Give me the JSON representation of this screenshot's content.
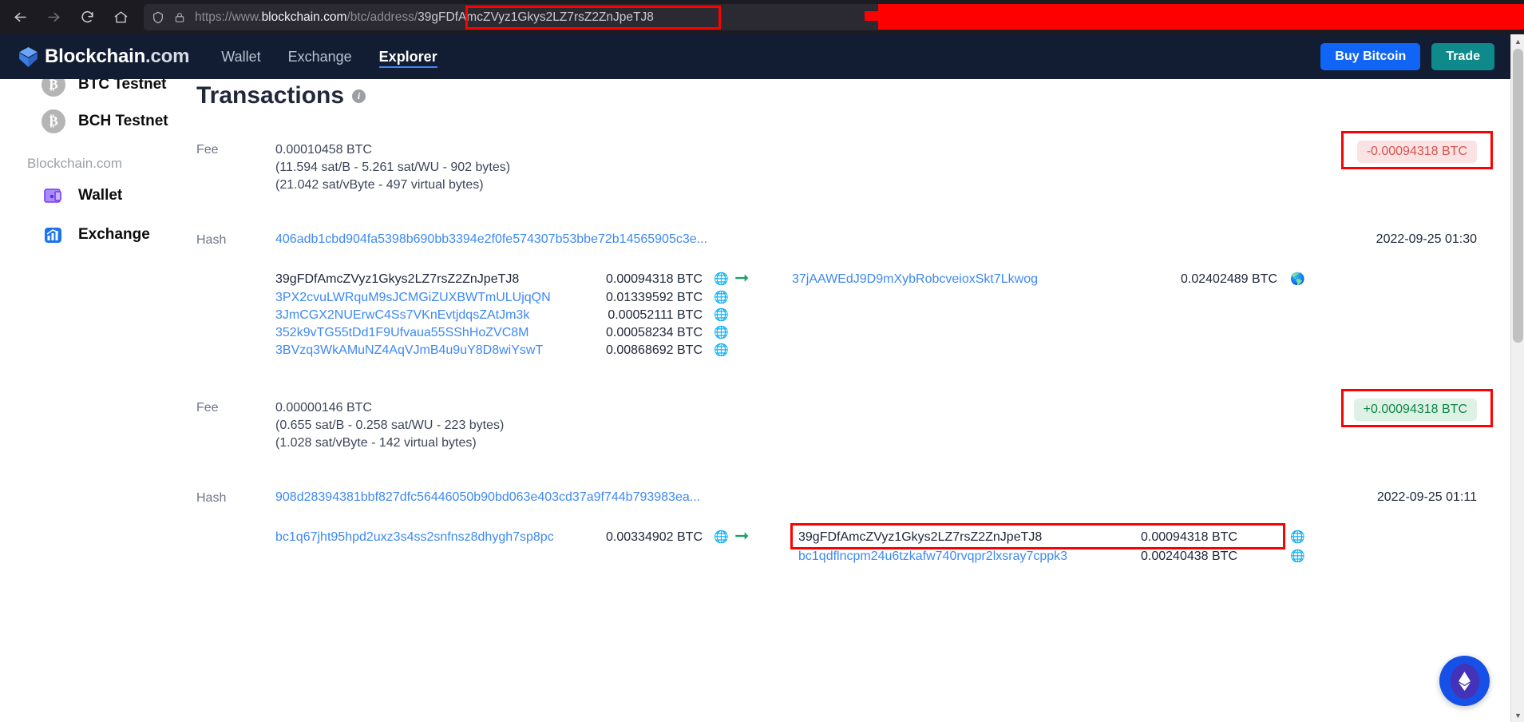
{
  "browser": {
    "back_icon": "back-arrow-icon",
    "forward_icon": "forward-arrow-icon",
    "reload_icon": "reload-icon",
    "home_icon": "home-icon",
    "shield_icon": "shield-icon",
    "lock_icon": "lock-icon",
    "url_prefix": "https://www.",
    "url_domain": "blockchain.com",
    "url_path": "/btc/address/",
    "url_address": "39gFDfAmcZVyz1Gkys2LZ7rsZ2ZnJpeTJ8",
    "annotation_color": "#ff0000"
  },
  "header": {
    "brand": "Blockchain",
    "brand_suffix": ".com",
    "nav": [
      {
        "label": "Wallet",
        "active": false
      },
      {
        "label": "Exchange",
        "active": false
      },
      {
        "label": "Explorer",
        "active": true
      }
    ],
    "buy_bitcoin_label": "Buy Bitcoin",
    "trade_label": "Trade",
    "buy_bitcoin_color": "#1165f6",
    "trade_color": "#0e8a8a",
    "background_color": "#121d33"
  },
  "sidebar": {
    "items": [
      {
        "label": "BTC Testnet",
        "icon": "bitcoin-coin-icon"
      },
      {
        "label": "BCH Testnet",
        "icon": "bitcoin-cash-coin-icon"
      }
    ],
    "group_label": "Blockchain.com",
    "links": [
      {
        "label": "Wallet",
        "icon": "wallet-icon"
      },
      {
        "label": "Exchange",
        "icon": "exchange-chart-icon"
      }
    ]
  },
  "main": {
    "title": "Transactions",
    "info_icon": "info-icon",
    "fee_label": "Fee",
    "hash_label": "Hash",
    "transactions": [
      {
        "fee_amount": "0.00010458 BTC",
        "fee_detail_1": "(11.594 sat/B - 5.261 sat/WU - 902 bytes)",
        "fee_detail_2": "(21.042 sat/vByte - 497 virtual bytes)",
        "balance_delta": "-0.00094318 BTC",
        "balance_delta_sign": "negative",
        "hash": "406adb1cbd904fa5398b690bb3394e2f0fe574307b53bbe72b14565905c3e...",
        "timestamp": "2022-09-25 01:30",
        "inputs": [
          {
            "address": "39gFDfAmcZVyz1Gkys2LZ7rsZ2ZnJpeTJ8",
            "amount": "0.00094318 BTC",
            "highlight": false,
            "is_link": false,
            "globe": "blue"
          },
          {
            "address": "3PX2cvuLWRquM9sJCMGiZUXBWTmULUjqQN",
            "amount": "0.01339592 BTC",
            "highlight": false,
            "is_link": true,
            "globe": "blue"
          },
          {
            "address": "3JmCGX2NUErwC4Ss7VKnEvtjdqsZAtJm3k",
            "amount": "0.00052111 BTC",
            "highlight": false,
            "is_link": true,
            "globe": "blue"
          },
          {
            "address": "352k9vTG55tDd1F9Ufvaua55SShHoZVC8M",
            "amount": "0.00058234 BTC",
            "highlight": false,
            "is_link": true,
            "globe": "blue"
          },
          {
            "address": "3BVzq3WkAMuNZ4AqVJmB4u9uY8D8wiYswT",
            "amount": "0.00868692 BTC",
            "highlight": false,
            "is_link": true,
            "globe": "blue"
          }
        ],
        "outputs": [
          {
            "address": "37jAAWEdJ9D9mXybRobcveioxSkt7Lkwog",
            "amount": "0.02402489 BTC",
            "highlight": false,
            "is_link": true,
            "globe": "green"
          }
        ]
      },
      {
        "fee_amount": "0.00000146 BTC",
        "fee_detail_1": "(0.655 sat/B - 0.258 sat/WU - 223 bytes)",
        "fee_detail_2": "(1.028 sat/vByte - 142 virtual bytes)",
        "balance_delta": "+0.00094318 BTC",
        "balance_delta_sign": "positive",
        "hash": "908d28394381bbf827dfc56446050b90bd063e403cd37a9f744b793983ea...",
        "timestamp": "2022-09-25 01:11",
        "inputs": [
          {
            "address": "bc1q67jht95hpd2uxz3s4ss2snfnsz8dhygh7sp8pc",
            "amount": "0.00334902 BTC",
            "highlight": false,
            "is_link": true,
            "globe": "blue"
          }
        ],
        "outputs": [
          {
            "address": "39gFDfAmcZVyz1Gkys2LZ7rsZ2ZnJpeTJ8",
            "amount": "0.00094318 BTC",
            "highlight": true,
            "is_link": false,
            "globe": "red"
          },
          {
            "address": "bc1qdflncpm24u6tzkafw740rvqpr2lxsray7cppk3",
            "amount": "0.00240438 BTC",
            "highlight": false,
            "is_link": true,
            "globe": "red"
          }
        ]
      }
    ]
  },
  "floating_action": {
    "icon": "ethereum-icon",
    "color": "#1650e6"
  }
}
